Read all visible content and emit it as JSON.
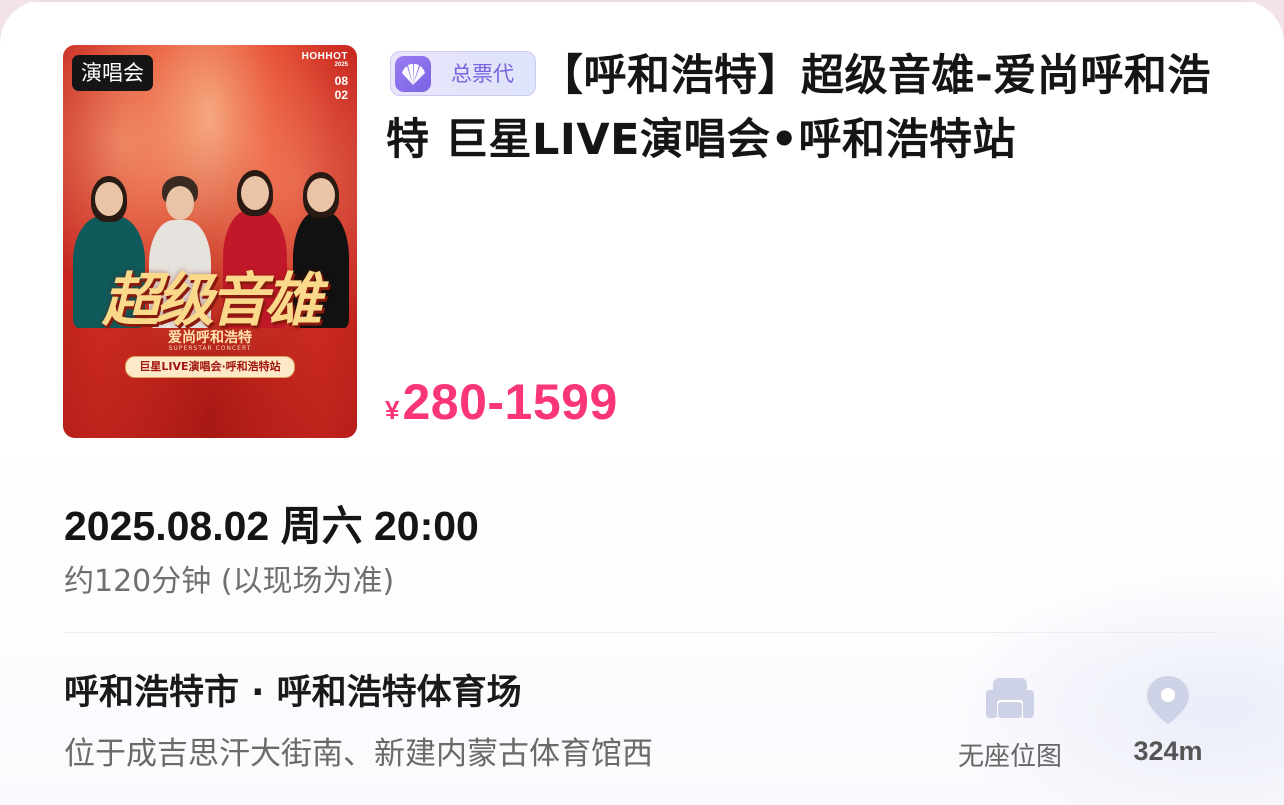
{
  "poster": {
    "tag": "演唱会",
    "corner_city": "HOHHOT",
    "corner_year": "2025",
    "corner_month": "08",
    "corner_day": "02",
    "title": "超级音雄",
    "subtitle": "爱尚呼和浩特",
    "subtitle_en": "SUPERSTAR CONCERT",
    "pill": "巨星LIVE演唱会·呼和浩特站"
  },
  "event": {
    "badge": "总票代",
    "title": "【呼和浩特】超级音雄-爱尚呼和浩特  巨星LIVE演唱会•呼和浩特站",
    "price_currency": "¥",
    "price_range": "280-1599"
  },
  "schedule": {
    "datetime": "2025.08.02 周六 20:00",
    "duration": "约120分钟 (以现场为准)"
  },
  "venue": {
    "name": "呼和浩特市 · 呼和浩特体育场",
    "address": "位于成吉思汗大街南、新建内蒙古体育馆西",
    "seat_map_label": "无座位图",
    "distance": "324m"
  },
  "colors": {
    "price": "#fb3579",
    "badge_text": "#7a64df",
    "icon": "#cdd2e6"
  }
}
